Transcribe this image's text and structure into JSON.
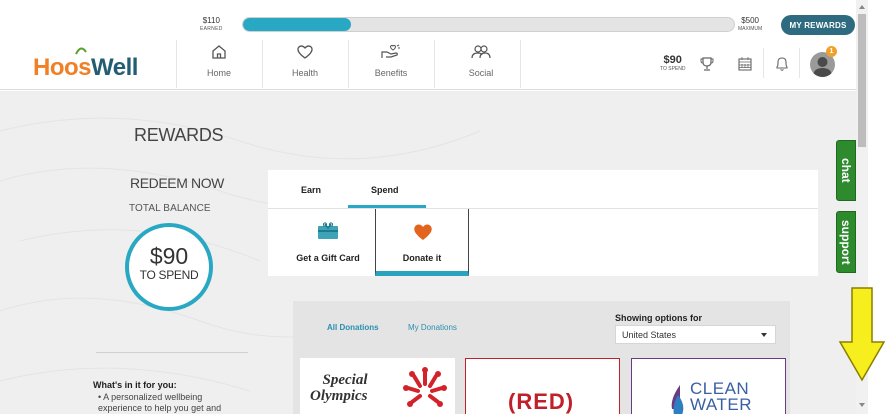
{
  "progress": {
    "earned_amount": "$110",
    "earned_label": "EARNED",
    "fill_percent": 22,
    "max_amount": "$500",
    "max_label": "MAXIMUM",
    "my_rewards_label": "MY REWARDS"
  },
  "header": {
    "logo_part1": "Hoos",
    "logo_part2": "Well",
    "nav": [
      {
        "label": "Home",
        "icon": "home-icon"
      },
      {
        "label": "Health",
        "icon": "heart-icon"
      },
      {
        "label": "Benefits",
        "icon": "hand-heart-icon"
      },
      {
        "label": "Social",
        "icon": "people-icon"
      }
    ],
    "spend_amount": "$90",
    "spend_label": "TO SPEND",
    "notification_count": "1"
  },
  "sidebar": {
    "title": "REWARDS",
    "redeem_title": "REDEEM NOW",
    "total_balance_label": "TOTAL BALANCE",
    "balance_amount": "$90",
    "balance_sub": "TO SPEND",
    "whats_in_title": "What's in it for you:",
    "bullet_text": "A personalized wellbeing experience to help you get and"
  },
  "tabs": {
    "earn_label": "Earn",
    "spend_label": "Spend",
    "options": [
      {
        "label": "Get a Gift Card",
        "icon": "gift-card-icon",
        "selected": false
      },
      {
        "label": "Donate it",
        "icon": "heart-icon",
        "selected": true
      }
    ]
  },
  "donations": {
    "all_label": "All Donations",
    "my_label": "My Donations",
    "showing_label": "Showing options for",
    "country_value": "United States",
    "cards": [
      {
        "name": "Special Olympics",
        "line1": "Special",
        "line2": "Olympics"
      },
      {
        "name": "(RED)",
        "text": "(RED)"
      },
      {
        "name": "Clean Water",
        "line1": "CLEAN",
        "line2": "WATER"
      }
    ]
  },
  "side_tabs": {
    "chat_label": "chat",
    "support_label": "support"
  },
  "colors": {
    "accent_teal": "#29a8c4",
    "brand_orange": "#f07f26",
    "brand_navy": "#235d73",
    "side_green": "#2d8a2d",
    "red": "#c0202a"
  }
}
